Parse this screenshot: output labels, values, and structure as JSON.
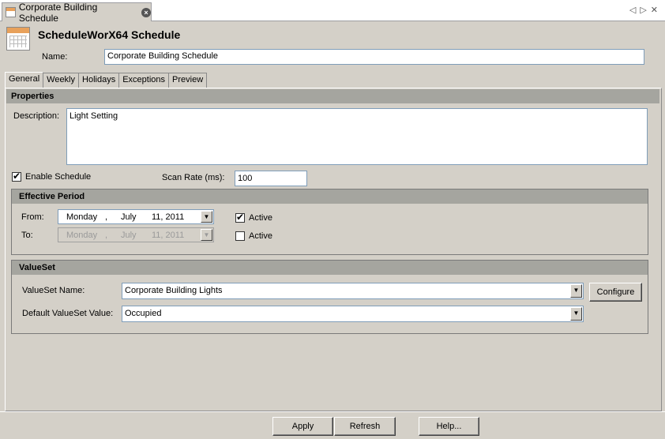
{
  "doc_tab": {
    "title": "Corporate Building Schedule"
  },
  "header": {
    "title": "ScheduleWorX64 Schedule"
  },
  "name": {
    "label": "Name:",
    "value": "Corporate Building Schedule"
  },
  "tabs": [
    {
      "label": "General",
      "active": true
    },
    {
      "label": "Weekly"
    },
    {
      "label": "Holidays"
    },
    {
      "label": "Exceptions"
    },
    {
      "label": "Preview"
    }
  ],
  "properties": {
    "heading": "Properties",
    "description_label": "Description:",
    "description_value": "Light Setting",
    "enable_label": "Enable Schedule",
    "enable_checked": true,
    "scan_rate_label": "Scan Rate (ms):",
    "scan_rate_value": "100"
  },
  "effective_period": {
    "heading": "Effective Period",
    "from_label": "From:",
    "from": {
      "day": "Monday",
      "sep": ",",
      "month": "July",
      "date": "11, 2011"
    },
    "from_active_label": "Active",
    "from_active_checked": true,
    "to_label": "To:",
    "to": {
      "day": "Monday",
      "sep": ",",
      "month": "July",
      "date": "11, 2011"
    },
    "to_active_label": "Active",
    "to_active_checked": false
  },
  "valueset": {
    "heading": "ValueSet",
    "name_label": "ValueSet Name:",
    "name_value": "Corporate Building Lights",
    "configure_label": "Configure",
    "default_label": "Default ValueSet Value:",
    "default_value": "Occupied"
  },
  "footer": {
    "apply_label": "Apply",
    "refresh_label": "Refresh",
    "help_label": "Help..."
  }
}
